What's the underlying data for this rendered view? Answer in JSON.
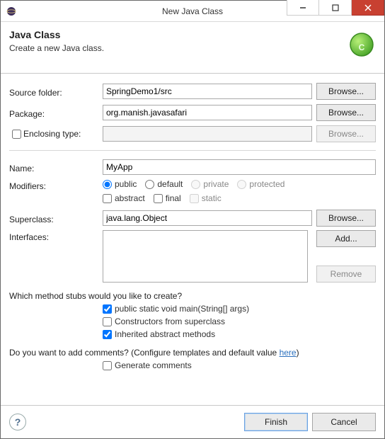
{
  "window": {
    "title": "New Java Class"
  },
  "header": {
    "title": "Java Class",
    "subtitle": "Create a new Java class."
  },
  "labels": {
    "sourceFolder": "Source folder:",
    "package": "Package:",
    "enclosingType": "Enclosing type:",
    "name": "Name:",
    "modifiers": "Modifiers:",
    "superclass": "Superclass:",
    "interfaces": "Interfaces:",
    "stubsQuestion": "Which method stubs would you like to create?",
    "commentsQuestionPrefix": "Do you want to add comments? (Configure templates and default value ",
    "commentsQuestionLink": "here",
    "commentsQuestionSuffix": ")"
  },
  "fields": {
    "sourceFolder": "SpringDemo1/src",
    "package": "org.manish.javasafari",
    "enclosingType": "",
    "name": "MyApp",
    "superclass": "java.lang.Object"
  },
  "modifiers": {
    "public": "public",
    "default": "default",
    "private": "private",
    "protected": "protected",
    "abstract": "abstract",
    "final": "final",
    "static": "static"
  },
  "stubs": {
    "main": "public static void main(String[] args)",
    "constructors": "Constructors from superclass",
    "inherited": "Inherited abstract methods"
  },
  "comments": {
    "generate": "Generate comments"
  },
  "buttons": {
    "browse": "Browse...",
    "add": "Add...",
    "remove": "Remove",
    "finish": "Finish",
    "cancel": "Cancel"
  }
}
